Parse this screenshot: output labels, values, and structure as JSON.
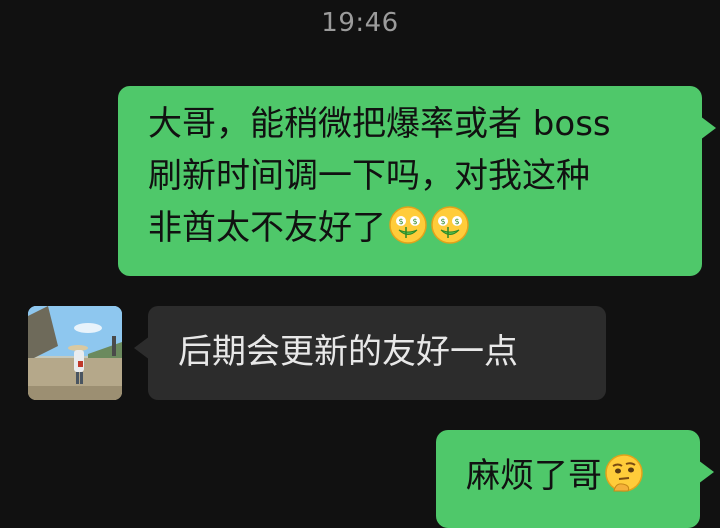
{
  "chat": {
    "timestamp": "19:46",
    "messages": [
      {
        "direction": "outgoing",
        "lines": [
          "大哥，能稍微把爆率或者 boss",
          "刷新时间调一下吗，对我这种",
          "非酋太不友好了"
        ],
        "emojis": [
          "money-mouth-face-icon",
          "money-mouth-face-icon"
        ]
      },
      {
        "direction": "incoming",
        "text": "后期会更新的友好一点"
      },
      {
        "direction": "outgoing",
        "text": "麻烦了哥",
        "emojis": [
          "thinking-face-icon"
        ]
      }
    ]
  },
  "colors": {
    "background": "#111111",
    "outgoing_bubble": "#4fc86a",
    "incoming_bubble": "#2c2c2c",
    "timestamp": "#9b9b9b"
  }
}
